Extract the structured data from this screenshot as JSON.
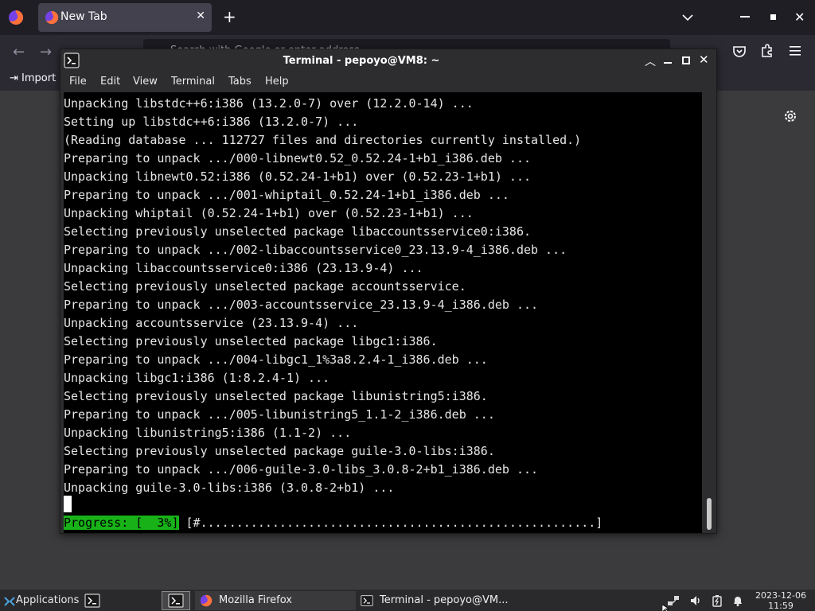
{
  "firefox": {
    "tab_title": "New Tab",
    "url_placeholder": "Search with Google or enter address",
    "bookmark_import": "Import"
  },
  "terminal": {
    "title": "Terminal - pepoyo@VM8: ~",
    "menu": [
      "File",
      "Edit",
      "View",
      "Terminal",
      "Tabs",
      "Help"
    ],
    "lines": [
      "Unpacking libstdc++6:i386 (13.2.0-7) over (12.2.0-14) ...",
      "Setting up libstdc++6:i386 (13.2.0-7) ...",
      "(Reading database ... 112727 files and directories currently installed.)",
      "Preparing to unpack .../000-libnewt0.52_0.52.24-1+b1_i386.deb ...",
      "Unpacking libnewt0.52:i386 (0.52.24-1+b1) over (0.52.23-1+b1) ...",
      "Preparing to unpack .../001-whiptail_0.52.24-1+b1_i386.deb ...",
      "Unpacking whiptail (0.52.24-1+b1) over (0.52.23-1+b1) ...",
      "Selecting previously unselected package libaccountsservice0:i386.",
      "Preparing to unpack .../002-libaccountsservice0_23.13.9-4_i386.deb ...",
      "Unpacking libaccountsservice0:i386 (23.13.9-4) ...",
      "Selecting previously unselected package accountsservice.",
      "Preparing to unpack .../003-accountsservice_23.13.9-4_i386.deb ...",
      "Unpacking accountsservice (23.13.9-4) ...",
      "Selecting previously unselected package libgc1:i386.",
      "Preparing to unpack .../004-libgc1_1%3a8.2.4-1_i386.deb ...",
      "Unpacking libgc1:i386 (1:8.2.4-1) ...",
      "Selecting previously unselected package libunistring5:i386.",
      "Preparing to unpack .../005-libunistring5_1.1-2_i386.deb ...",
      "Unpacking libunistring5:i386 (1.1-2) ...",
      "Selecting previously unselected package guile-3.0-libs:i386.",
      "Preparing to unpack .../006-guile-3.0-libs_3.0.8-2+b1_i386.deb ...",
      "Unpacking guile-3.0-libs:i386 (3.0.8-2+b1) ..."
    ],
    "progress_label": "Progress: [  3%]",
    "progress_bar": " [#.......................................................]",
    "progress_percent": 3
  },
  "taskbar": {
    "applications_label": "Applications",
    "tasks": [
      {
        "label": "Mozilla Firefox",
        "icon": "firefox-icon"
      },
      {
        "label": "Terminal - pepoyo@VM...",
        "icon": "terminal-icon"
      }
    ],
    "clock_date": "2023-12-06",
    "clock_time": "11:59"
  },
  "colors": {
    "progress_accent": "#18b218",
    "terminal_bg": "#000000",
    "chrome_bg": "#2d2d30"
  }
}
